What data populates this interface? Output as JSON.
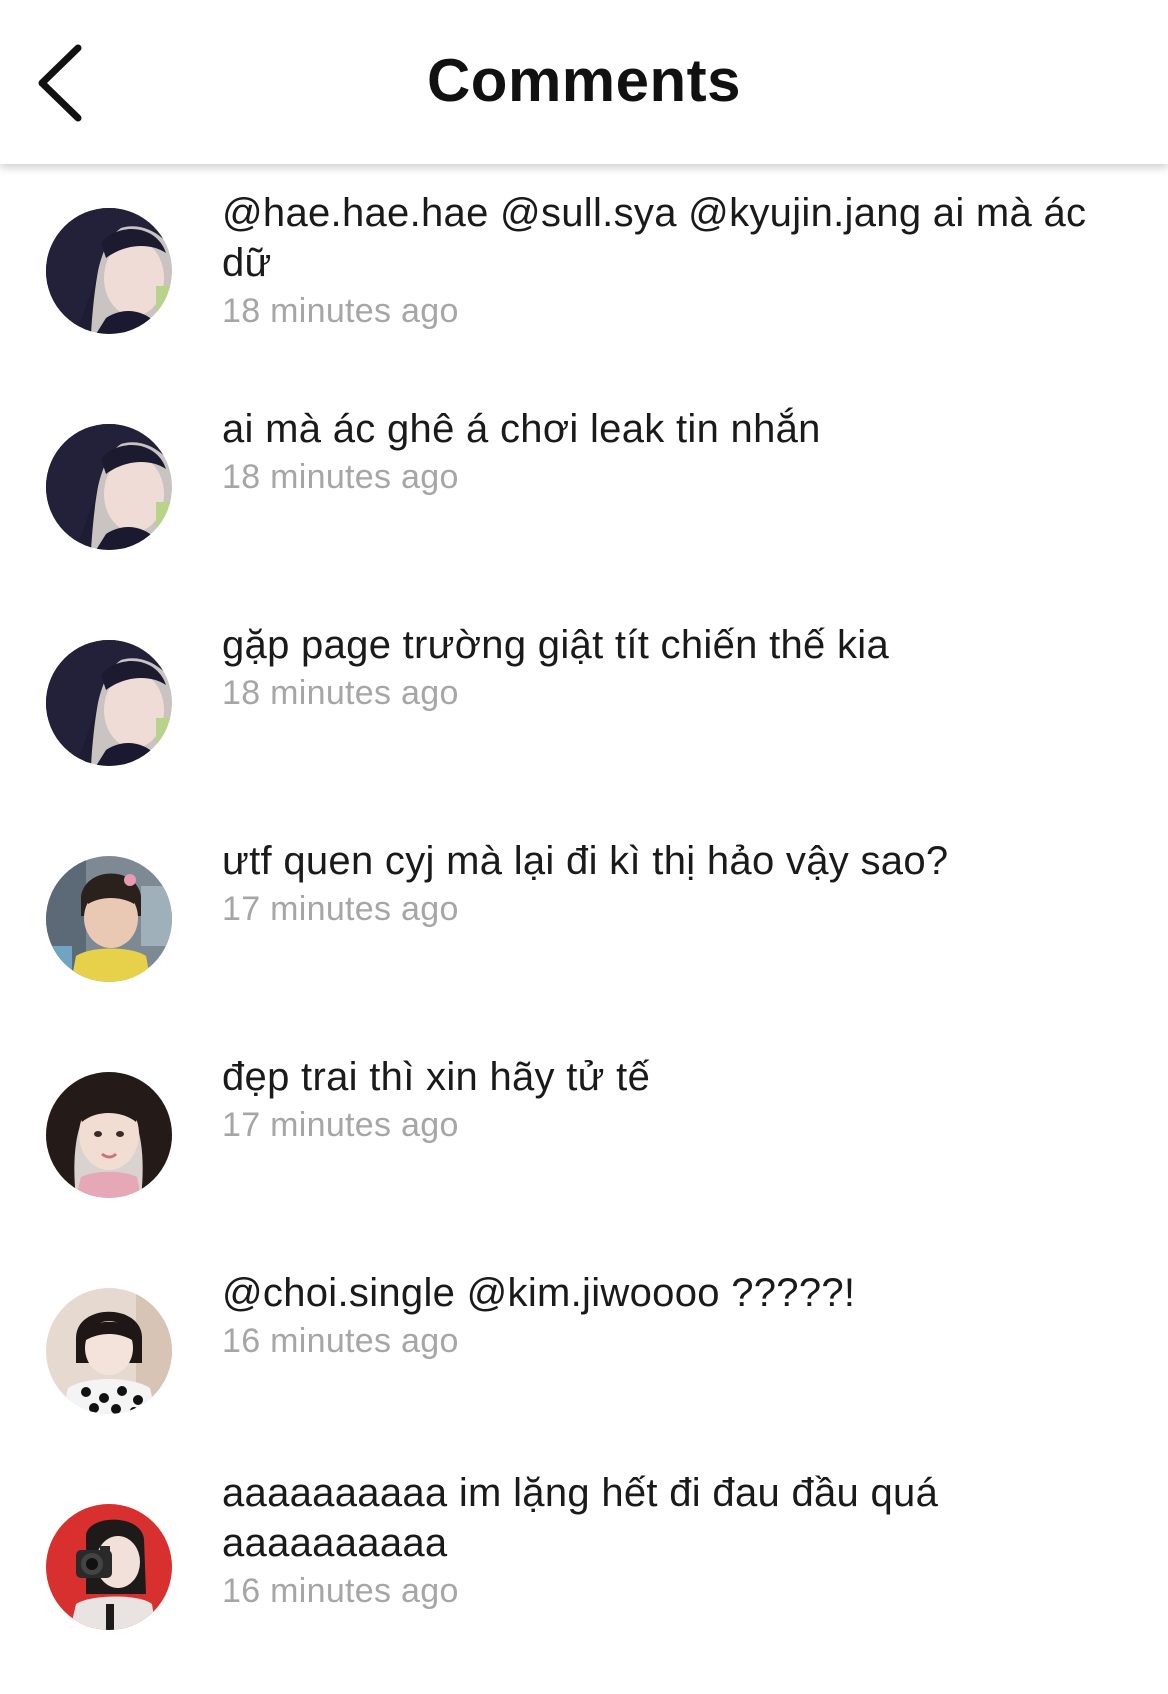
{
  "header": {
    "title": "Comments",
    "back_icon": "chevron-left-icon"
  },
  "comments": [
    {
      "text": "@hae.hae.hae @sull.sya @kyujin.jang ai mà ác dữ",
      "time": "18 minutes ago",
      "avatar": "avatar-dark-hair-girl"
    },
    {
      "text": "ai mà ác ghê á chơi leak tin nhắn",
      "time": "18 minutes ago",
      "avatar": "avatar-dark-hair-girl"
    },
    {
      "text": "gặp page trường giật tít chiến thế kia",
      "time": "18 minutes ago",
      "avatar": "avatar-dark-hair-girl"
    },
    {
      "text": "ưtf quen cyj mà lại đi kì thị hảo vậy sao?",
      "time": "17 minutes ago",
      "avatar": "avatar-child"
    },
    {
      "text": "đẹp trai thì xin hãy tử tế",
      "time": "17 minutes ago",
      "avatar": "avatar-girl-pink"
    },
    {
      "text": "@choi.single @kim.jiwoooo ?????!",
      "time": "16 minutes ago",
      "avatar": "avatar-girl-patterned-shirt"
    },
    {
      "text": "aaaaaaaaaa im lặng hết đi đau đầu quá aaaaaaaaaa",
      "time": "16 minutes ago",
      "avatar": "avatar-girl-camera-red"
    }
  ]
}
